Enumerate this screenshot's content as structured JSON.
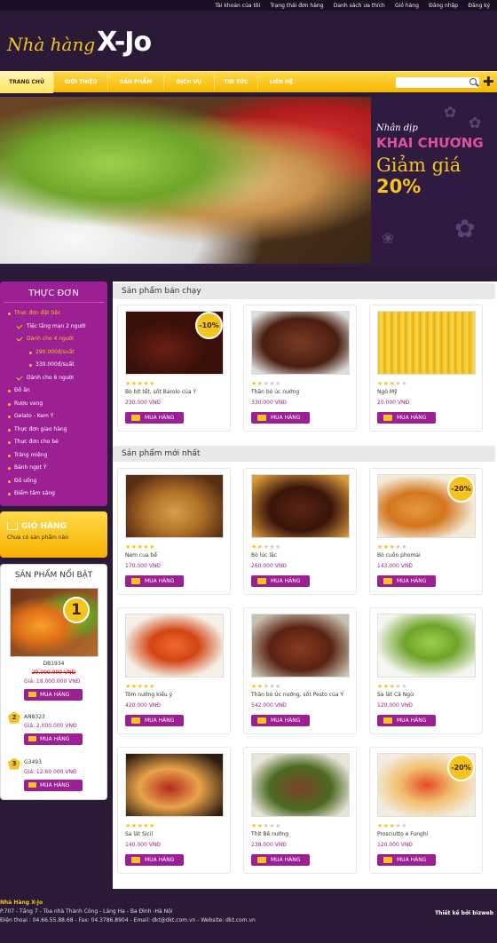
{
  "topbar": {
    "links": [
      "Tài khoản của tôi",
      "Trạng thái đơn hàng",
      "Danh sách ưa thích",
      "Giỏ hàng",
      "Đăng nhập",
      "Đăng ký"
    ]
  },
  "logo": {
    "script": "Nhà hàng",
    "brand": "X-Jo"
  },
  "nav": {
    "items": [
      "Trang chủ",
      "Giới thiệu",
      "Sản phẩm",
      "Dịch vụ",
      "Tin tức",
      "Liên hệ"
    ],
    "search_placeholder": ""
  },
  "banner": {
    "line1": "Nhân dịp",
    "line2": "KHAI CHƯƠNG",
    "line3": "Giảm giá",
    "line4": "20%"
  },
  "sidebar": {
    "menu_title": "Thực đơn",
    "menu": [
      {
        "label": "Thực đơn đặt tiệc",
        "level": 0,
        "highlight": true
      },
      {
        "label": "Tiệc lẩng mạn 2 người",
        "level": 1,
        "highlight": false
      },
      {
        "label": "Dành cho 4 người",
        "level": 1,
        "highlight": true
      },
      {
        "label": "290.000đ/suất",
        "level": 2,
        "highlight": true
      },
      {
        "label": "330.000đ/suất",
        "level": 2,
        "highlight": false
      },
      {
        "label": "Dành cho 6 người",
        "level": 1,
        "highlight": false
      },
      {
        "label": "Đồ ăn",
        "level": 0,
        "highlight": false
      },
      {
        "label": "Rượu vang",
        "level": 0,
        "highlight": false
      },
      {
        "label": "Gelato - Kem Ý",
        "level": 0,
        "highlight": false
      },
      {
        "label": "Thực đơn giao hàng",
        "level": 0,
        "highlight": false
      },
      {
        "label": "Thực đơn cho bé",
        "level": 0,
        "highlight": false
      },
      {
        "label": "Tráng miệng",
        "level": 0,
        "highlight": false
      },
      {
        "label": "Bánh ngọt Ý",
        "level": 0,
        "highlight": false
      },
      {
        "label": "Đồ uống",
        "level": 0,
        "highlight": false
      },
      {
        "label": "Điểm tâm sáng",
        "level": 0,
        "highlight": false
      }
    ],
    "cart": {
      "title": "Giỏ hàng",
      "status": "Chưa có sản phẩm nào"
    },
    "featured": {
      "title": "Sản phẩm nổi bật",
      "top": {
        "rank": "1",
        "code": "DB1934",
        "old_price": "20.000.000 VNĐ",
        "price": "Giá: 18.000.000 VNĐ",
        "button": "MUA HÀNG"
      },
      "others": [
        {
          "rank": "2",
          "code": "AN8323",
          "price": "Giá: 2.000.000 VNĐ",
          "button": "MUA HÀNG"
        },
        {
          "rank": "3",
          "code": "G3493",
          "price": "Giá: 12.60 000 VNĐ",
          "button": "MUA HÀNG"
        }
      ]
    }
  },
  "main": {
    "bestsellers_title": "Sản phẩm bán chạy",
    "newest_title": "Sản phẩm mới nhất",
    "bestsellers": [
      {
        "name": "Bò bít tết, sốt Barolo của Ý",
        "price": "230.000 VNĐ",
        "stars": 5,
        "badge": "-10%",
        "button": "MUA HÀNG"
      },
      {
        "name": "Thăn bò úc nướng",
        "price": "330.000 VNĐ",
        "stars": 2,
        "badge": "",
        "button": "MUA HÀNG"
      },
      {
        "name": "Ngô Mỹ",
        "price": "20.000 VNĐ",
        "stars": 3,
        "badge": "",
        "button": "MUA HÀNG"
      }
    ],
    "newest": [
      {
        "name": "Nem cua bể",
        "price": "170.000 VNĐ",
        "stars": 5,
        "badge": "",
        "button": "MUA HÀNG"
      },
      {
        "name": "Bò lúc lắc",
        "price": "260.000 VNĐ",
        "stars": 2,
        "badge": "",
        "button": "MUA HÀNG"
      },
      {
        "name": "Bò cuốn phomai",
        "price": "143.000 VNĐ",
        "stars": 3,
        "badge": "-20%",
        "button": "MUA HÀNG"
      },
      {
        "name": "Tôm nướng kiểu ý",
        "price": "420.000 VNĐ",
        "stars": 5,
        "badge": "",
        "button": "MUA HÀNG"
      },
      {
        "name": "Thăn bò Úc nướng, sốt Pesto của Ý",
        "price": "542.000 VNĐ",
        "stars": 2,
        "badge": "",
        "button": "MUA HÀNG"
      },
      {
        "name": "Sa lát Cá Ngừ",
        "price": "120.000 VNĐ",
        "stars": 3,
        "badge": "",
        "button": "MUA HÀNG"
      },
      {
        "name": "Sa lát Sicil",
        "price": "140.000 VNĐ",
        "stars": 5,
        "badge": "",
        "button": "MUA HÀNG"
      },
      {
        "name": "Thịt Bê nướng",
        "price": "238.000 VNĐ",
        "stars": 2,
        "badge": "",
        "button": "MUA HÀNG"
      },
      {
        "name": "Prosciutto e Funghi",
        "price": "120.000 VNĐ",
        "stars": 3,
        "badge": "-20%",
        "button": "MUA HÀNG"
      }
    ]
  },
  "footer": {
    "name": "Nhà Hàng X-Jo",
    "address": "P.707 - Tầng 7 - Tòa nhà Thành Công - Láng Hạ - Ba Đình -Hà Nội",
    "contact": "Điện thoại : 04.66.55.88.68 - Fax: 04.3786.8904 - Email: dkt@dkt.com.vn  -  Website: dkt.com.vn",
    "credit": "Thiết kế bởi bizweb"
  },
  "colors": {
    "purple": "#9c2094",
    "gold": "#f4c41c",
    "dark": "#2a1a38"
  }
}
